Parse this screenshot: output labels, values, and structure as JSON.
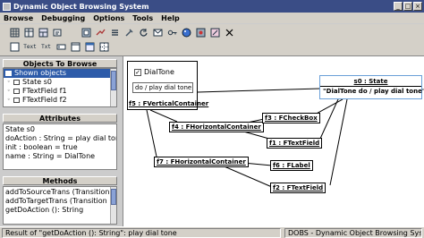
{
  "window": {
    "title": "Dynamic Object Browsing System"
  },
  "menu": [
    "Browse",
    "Debugging",
    "Options",
    "Tools",
    "Help"
  ],
  "toolbar": {
    "row1": [
      "grid-icon",
      "table-icon",
      "table-alt-icon",
      "edit-icon",
      "blank-icon",
      "panel-icon",
      "link-icon",
      "list-icon",
      "tools-icon",
      "refresh-icon",
      "mail-icon",
      "key-icon",
      "palette-icon",
      "plugin-icon",
      "blank2-icon",
      "close-icon"
    ],
    "row2": [
      "box-icon",
      "text-label",
      "txt-label",
      "input-label",
      "frame-icon",
      "window-icon",
      "frame2-icon"
    ],
    "row2_text": {
      "text": "Text",
      "txt": "Txt"
    }
  },
  "objects_panel": {
    "title": "Objects To Browse",
    "items": [
      {
        "label": "Shown objects",
        "selected": true
      },
      {
        "label": "State s0",
        "selected": false
      },
      {
        "label": "FTextField f1",
        "selected": false
      },
      {
        "label": "FTextField f2",
        "selected": false
      }
    ]
  },
  "attributes_panel": {
    "title": "Attributes",
    "items": [
      "State s0",
      "doAction : String = play dial tone",
      "init : boolean = true",
      "name : String = DialTone"
    ]
  },
  "methods_panel": {
    "title": "Methods",
    "items": [
      "addToSourceTrans (Transition",
      "addToTargetTrans (Transition",
      "getDoAction (): String"
    ]
  },
  "canvas": {
    "fvc": {
      "label": "f5 : FVerticalContainer",
      "checkbox_label": "DialTone",
      "checkbox_checked": true,
      "text_value": "do / play dial tone"
    },
    "state": {
      "title": "s0 : State",
      "value": "\"DialTone     do / play dial tone\""
    },
    "boxes": {
      "f4": "f4 : FHorizontalContainer",
      "f3": "f3 : FCheckBox",
      "f1": "f1 : FTextField",
      "f7": "f7 : FHorizontalContainer",
      "f6": "f6 : FLabel",
      "f2": "f2 : FTextField"
    }
  },
  "status": {
    "left": "Result of \"getDoAction (): String\":  play dial tone",
    "right": "DOBS - Dynamic Object Browsing System"
  },
  "colors": {
    "titlebar": "#3a4d86",
    "selection": "#2d5ba9",
    "state_border": "#6ba0d8"
  }
}
